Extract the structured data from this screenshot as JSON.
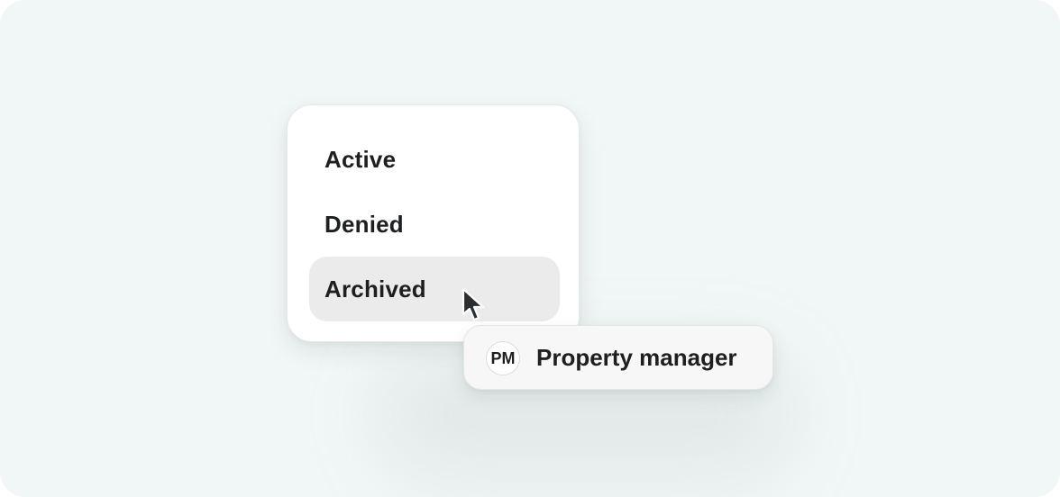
{
  "menu": {
    "items": [
      {
        "label": "Active"
      },
      {
        "label": "Denied"
      },
      {
        "label": "Archived",
        "state": "hovered"
      }
    ]
  },
  "chip": {
    "avatar_initials": "PM",
    "label": "Property manager"
  },
  "cursor": {
    "icon": "arrow-cursor-icon"
  },
  "colors": {
    "background": "#f1f6f6",
    "menu_bg": "#ffffff",
    "hover_bg": "#ebebeb",
    "text": "#1d1f20",
    "cursor": "#2b2f31"
  }
}
